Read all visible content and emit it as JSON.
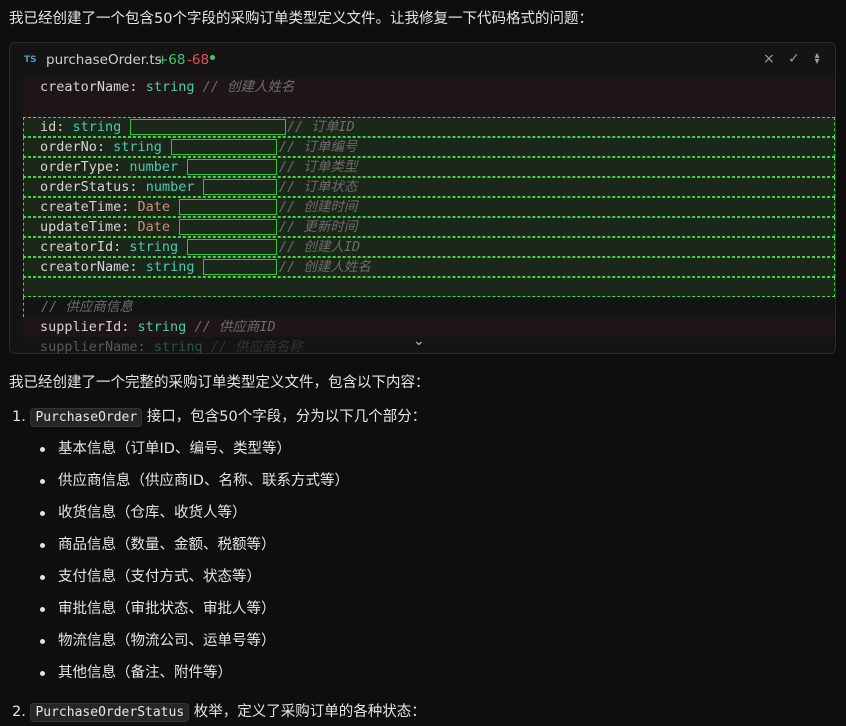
{
  "intro": "我已经创建了一个包含50个字段的采购订单类型定义文件。让我修复一下代码格式的问题：",
  "editor": {
    "lang_badge": "TS",
    "file_name": "purchaseOrder.ts",
    "additions": "+68",
    "deletions": "-68",
    "close_icon": "×",
    "accept_icon": "✓",
    "expand_icon": "⌃⌄",
    "collapse_chevron": "⌄",
    "lines": {
      "l0": {
        "key": "creatorName:",
        "type": "string",
        "comment": "// 创建人姓名"
      },
      "l1": {
        "key": "id:",
        "type": "string",
        "comment": "// 订单ID"
      },
      "l2": {
        "key": "orderNo:",
        "type": "string",
        "comment": "// 订单编号"
      },
      "l3": {
        "key": "orderType:",
        "type": "number",
        "comment": "// 订单类型"
      },
      "l4": {
        "key": "orderStatus:",
        "type": "number",
        "comment": "// 订单状态"
      },
      "l5": {
        "key": "createTime:",
        "type": "Date",
        "comment": "// 创建时间"
      },
      "l6": {
        "key": "updateTime:",
        "type": "Date",
        "comment": "// 更新时间"
      },
      "l7": {
        "key": "creatorId:",
        "type": "string",
        "comment": "// 创建人ID"
      },
      "l8": {
        "key": "creatorName:",
        "type": "string",
        "comment": "// 创建人姓名"
      },
      "l9": {
        "comment": "// 供应商信息"
      },
      "l10": {
        "key": "supplierId:",
        "type": "string",
        "comment": "// 供应商ID"
      },
      "l11": {
        "key": "supplierName:",
        "type": "string",
        "comment": "// 供应商名称"
      }
    }
  },
  "summary": {
    "lead": "我已经创建了一个完整的采购订单类型定义文件，包含以下内容：",
    "item1": {
      "num": "1.",
      "code": "PurchaseOrder",
      "text": " 接口，包含50个字段，分为以下几个部分："
    },
    "bullets": [
      "基本信息（订单ID、编号、类型等）",
      "供应商信息（供应商ID、名称、联系方式等）",
      "收货信息（仓库、收货人等）",
      "商品信息（数量、金额、税额等）",
      "支付信息（支付方式、状态等）",
      "审批信息（审批状态、审批人等）",
      "物流信息（物流公司、运单号等）",
      "其他信息（备注、附件等）"
    ],
    "item2": {
      "num": "2.",
      "code": "PurchaseOrderStatus",
      "text": " 枚举，定义了采购订单的各种状态："
    }
  }
}
